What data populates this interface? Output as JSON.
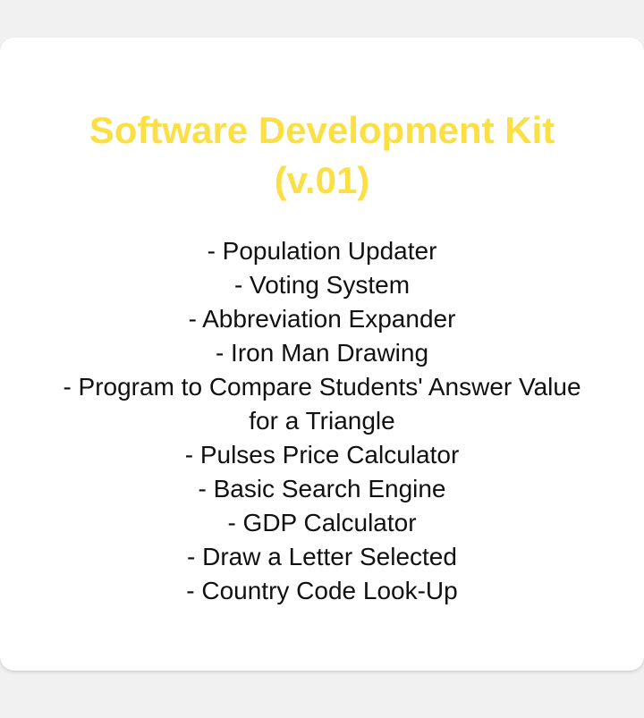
{
  "card": {
    "title_line1": "Software Development Kit",
    "title_line2": "(v.01)",
    "title_color": "#fadf45",
    "items": [
      "- Population Updater",
      "- Voting System",
      "- Abbreviation Expander",
      "- Iron Man Drawing",
      "- Program to Compare Students' Answer Value for a Triangle",
      "- Pulses Price Calculator",
      "- Basic Search Engine",
      "- GDP Calculator",
      "- Draw a Letter Selected",
      "- Country Code Look-Up"
    ]
  }
}
